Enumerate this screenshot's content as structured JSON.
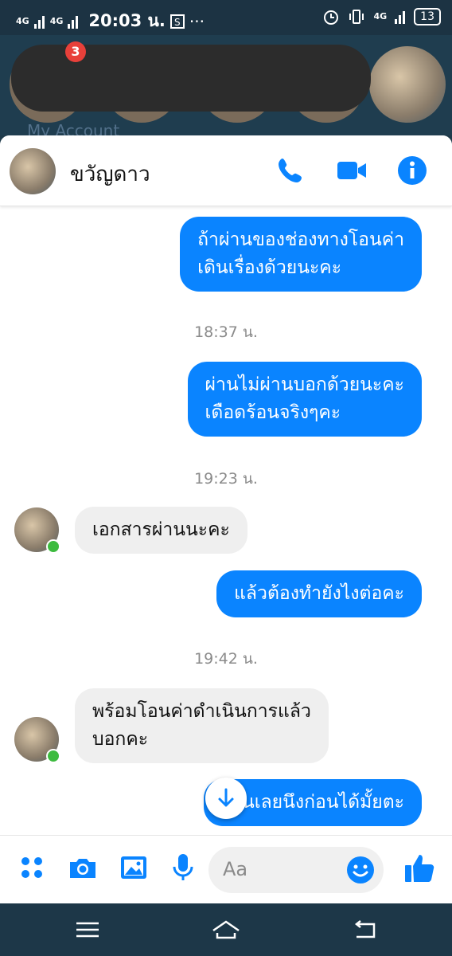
{
  "status_bar": {
    "network_left": [
      "4G",
      "4G"
    ],
    "time": "20:03 น.",
    "dots": "···",
    "network_right": "4G",
    "battery": "13"
  },
  "stories": {
    "badge_count": "3",
    "label": "My Account"
  },
  "header": {
    "contact_name": "ขวัญดาว"
  },
  "messages": [
    {
      "type": "out",
      "text": "ถ้าผ่านของช่องทางโอนค่า\nเดินเรื่องด้วยนะคะ"
    },
    {
      "type": "time",
      "text": "18:37 น."
    },
    {
      "type": "out",
      "text": "ผ่านไม่ผ่านบอกด้วยนะคะ\nเดือดร้อนจริงๆคะ"
    },
    {
      "type": "time",
      "text": "19:23 น."
    },
    {
      "type": "in",
      "text": "เอกสารผ่านนะคะ"
    },
    {
      "type": "out",
      "text": "แล้วต้องทำยังไงต่อคะ"
    },
    {
      "type": "time",
      "text": "19:42 น."
    },
    {
      "type": "in",
      "text": "พร้อมโอนค่าดำเนินการแล้ว\nบอกคะ"
    },
    {
      "type": "out",
      "text": "โอนเลยนึงก่อนได้มั้ยตะ"
    }
  ],
  "composer": {
    "placeholder": "Aa"
  },
  "colors": {
    "accent": "#0a84ff",
    "incoming_bubble": "#efefef",
    "online": "#3dbb3f"
  }
}
